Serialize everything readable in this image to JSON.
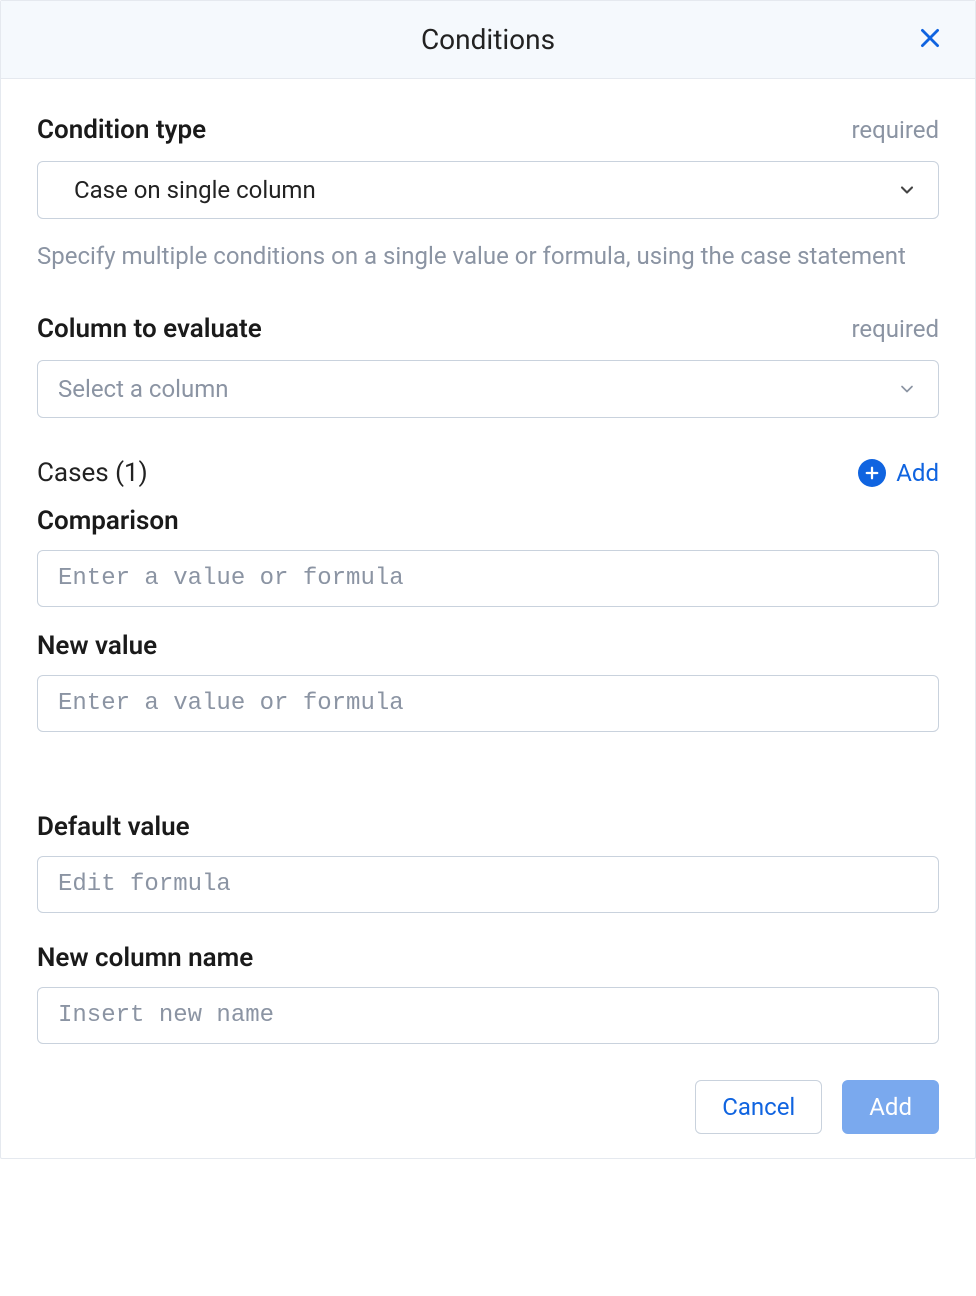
{
  "header": {
    "title": "Conditions"
  },
  "condition_type": {
    "label": "Condition type",
    "required_tag": "required",
    "value": "Case on single column",
    "help": "Specify multiple conditions on a single value or formula, using the case statement"
  },
  "column_eval": {
    "label": "Column to evaluate",
    "required_tag": "required",
    "placeholder": "Select a column"
  },
  "cases": {
    "heading": "Cases (1)",
    "add_label": "Add",
    "comparison_label": "Comparison",
    "comparison_placeholder": "Enter a value or formula",
    "newvalue_label": "New value",
    "newvalue_placeholder": "Enter a value or formula"
  },
  "default_value": {
    "label": "Default value",
    "placeholder": "Edit formula"
  },
  "new_column": {
    "label": "New column name",
    "placeholder": "Insert new name"
  },
  "footer": {
    "cancel": "Cancel",
    "add": "Add"
  }
}
